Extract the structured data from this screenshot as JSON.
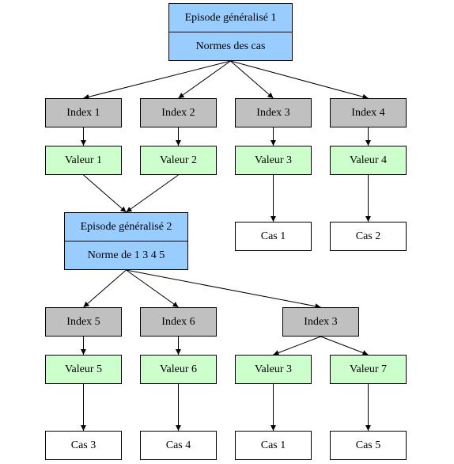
{
  "diagram": {
    "episodes": [
      {
        "id": "ep1",
        "title": "Episode généralisé 1",
        "subtitle": "Normes des cas"
      },
      {
        "id": "ep2",
        "title": "Episode généralisé 2",
        "subtitle": "Norme de 1 3 4 5"
      }
    ],
    "nodes": {
      "idx1": "Index 1",
      "idx2": "Index 2",
      "idx3": "Index 3",
      "idx4": "Index 4",
      "val1": "Valeur 1",
      "val2": "Valeur 2",
      "val3": "Valeur 3",
      "val4": "Valeur 4",
      "cas1": "Cas 1",
      "cas2": "Cas 2",
      "idx5": "Index 5",
      "idx6": "Index 6",
      "idx3b": "Index 3",
      "val5": "Valeur 5",
      "val6": "Valeur 6",
      "val3b": "Valeur 3",
      "val7": "Valeur 7",
      "cas3": "Cas 3",
      "cas4": "Cas 4",
      "cas1b": "Cas 1",
      "cas5": "Cas 5"
    },
    "edges": [
      [
        "ep1",
        "idx1"
      ],
      [
        "ep1",
        "idx2"
      ],
      [
        "ep1",
        "idx3"
      ],
      [
        "ep1",
        "idx4"
      ],
      [
        "idx1",
        "val1"
      ],
      [
        "idx2",
        "val2"
      ],
      [
        "idx3",
        "val3"
      ],
      [
        "idx4",
        "val4"
      ],
      [
        "val1",
        "ep2"
      ],
      [
        "val2",
        "ep2"
      ],
      [
        "val3",
        "cas1"
      ],
      [
        "val4",
        "cas2"
      ],
      [
        "ep2",
        "idx5"
      ],
      [
        "ep2",
        "idx6"
      ],
      [
        "ep2",
        "idx3b"
      ],
      [
        "idx5",
        "val5"
      ],
      [
        "idx6",
        "val6"
      ],
      [
        "idx3b",
        "val3b"
      ],
      [
        "idx3b",
        "val7"
      ],
      [
        "val5",
        "cas3"
      ],
      [
        "val6",
        "cas4"
      ],
      [
        "val3b",
        "cas1b"
      ],
      [
        "val7",
        "cas5"
      ]
    ],
    "colors": {
      "index": "#c0c0c0",
      "valeur": "#ccffcc",
      "episode": "#99ccff",
      "cas": "#ffffff"
    }
  }
}
